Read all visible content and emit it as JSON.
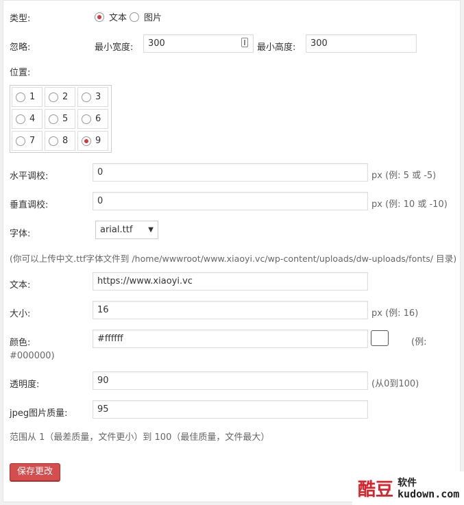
{
  "type_row": {
    "label": "类型:",
    "options": [
      {
        "label": "文本",
        "selected": true
      },
      {
        "label": "图片",
        "selected": false
      }
    ]
  },
  "ignore_row": {
    "label": "忽略:",
    "min_width_label": "最小宽度:",
    "min_width_value": "300",
    "min_height_label": "最小高度:",
    "min_height_value": "300"
  },
  "position_row": {
    "label": "位置:",
    "cells": [
      {
        "label": "1",
        "selected": false
      },
      {
        "label": "2",
        "selected": false
      },
      {
        "label": "3",
        "selected": false
      },
      {
        "label": "4",
        "selected": false
      },
      {
        "label": "5",
        "selected": false
      },
      {
        "label": "6",
        "selected": false
      },
      {
        "label": "7",
        "selected": false
      },
      {
        "label": "8",
        "selected": false
      },
      {
        "label": "9",
        "selected": true
      }
    ]
  },
  "h_adjust": {
    "label": "水平调校:",
    "value": "0",
    "note": "px (例:  5 或 -5)"
  },
  "v_adjust": {
    "label": "垂直调校:",
    "value": "0",
    "note": "px (例:  10 或 -10)"
  },
  "font_row": {
    "label": "字体:",
    "selected": "arial.ttf"
  },
  "font_note": "(你可以上传中文.ttf字体文件到 /home/wwwroot/www.xiaoyi.vc/wp-content/uploads/dw-uploads/fonts/ 目录)",
  "text_row": {
    "label": "文本:",
    "value": "https://www.xiaoyi.vc"
  },
  "size_row": {
    "label": "大小:",
    "value": "16",
    "note": "px (例:  16)"
  },
  "color_row": {
    "label": "颜色:",
    "value": "#ffffff",
    "note_a": "(例:",
    "note_b": "#000000)",
    "swatch": "#ffffff"
  },
  "opacity_row": {
    "label": "透明度:",
    "value": "90",
    "note": "(从0到100)"
  },
  "jpeg_row": {
    "label": "jpeg图片质量:",
    "value": "95",
    "note": "范围从 1（最差质量，文件更小）到 100（最佳质量，文件最大）"
  },
  "save_button": "保存更改",
  "watermark": {
    "logo": "酷豆",
    "soft": "软件",
    "domain": "kudown.com"
  },
  "colors": {
    "accent": "#d54e4e",
    "radio_dot": "#d63638"
  }
}
